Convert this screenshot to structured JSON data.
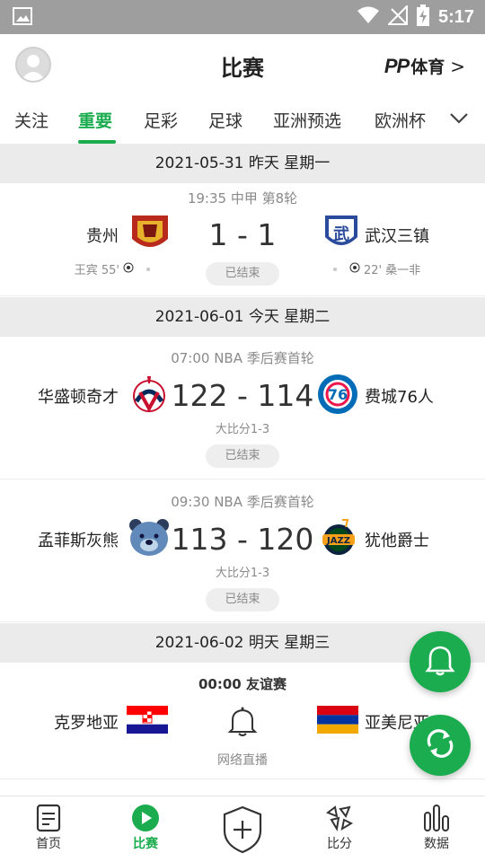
{
  "status_bar": {
    "time": "5:17"
  },
  "header": {
    "title": "比赛",
    "brand_logo": "PP",
    "brand_text": "体育",
    "brand_chevron": ">"
  },
  "tabs": [
    {
      "label": "关注"
    },
    {
      "label": "重要",
      "active": true
    },
    {
      "label": "足彩"
    },
    {
      "label": "足球"
    },
    {
      "label": "亚洲预选"
    },
    {
      "label": "欧洲杯"
    }
  ],
  "days": [
    {
      "date": "2021-05-31 昨天 星期一"
    },
    {
      "date": "2021-06-01 今天 星期二"
    },
    {
      "date": "2021-06-02 明天 星期三"
    }
  ],
  "matches": [
    {
      "meta": "19:35 中甲 第8轮",
      "home": "贵州",
      "away": "武汉三镇",
      "score": "1 - 1",
      "status": "已结束",
      "home_scorer": "王宾 55'",
      "away_scorer": "22' 桑一非"
    },
    {
      "meta": "07:00 NBA 季后赛首轮",
      "home": "华盛顿奇才",
      "away": "费城76人",
      "score": "122 - 114",
      "series": "大比分1-3",
      "status": "已结束"
    },
    {
      "meta": "09:30 NBA 季后赛首轮",
      "home": "孟菲斯灰熊",
      "away": "犹他爵士",
      "score": "113 - 120",
      "series": "大比分1-3",
      "status": "已结束"
    },
    {
      "meta": "00:00 友谊赛",
      "home": "克罗地亚",
      "away": "亚美尼亚",
      "broadcast": "网络直播"
    }
  ],
  "bottom_nav": [
    {
      "label": "首页",
      "icon": "document-icon"
    },
    {
      "label": "比赛",
      "icon": "play-icon",
      "active": true
    },
    {
      "label": "",
      "icon": "shield-plus-icon"
    },
    {
      "label": "比分",
      "icon": "score-icon"
    },
    {
      "label": "数据",
      "icon": "bar-chart-icon"
    }
  ],
  "colors": {
    "accent": "#1aac4e",
    "status_bar": "#9e9e9e",
    "date_bar": "#ebebeb"
  }
}
